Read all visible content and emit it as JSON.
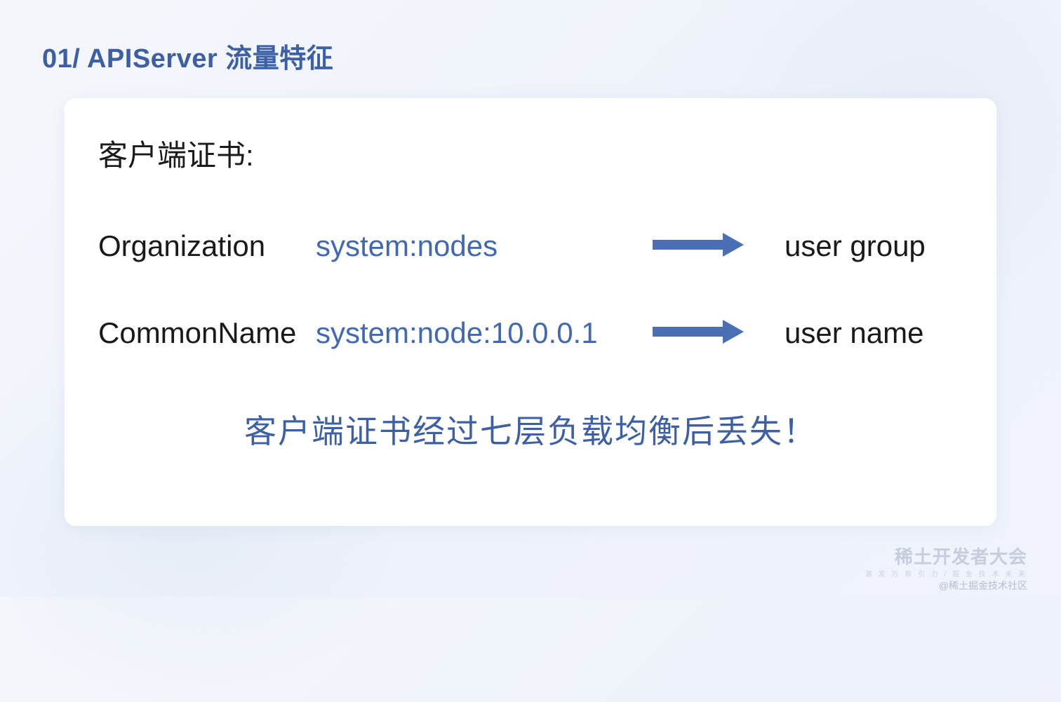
{
  "title": "01/ APIServer 流量特征",
  "card": {
    "heading": "客户端证书:",
    "rows": [
      {
        "label": "Organization",
        "value": "system:nodes",
        "result": "user group"
      },
      {
        "label": "CommonName",
        "value": "system:node:10.0.0.1",
        "result": "user name"
      }
    ],
    "conclusion": "客户端证书经过七层负载均衡后丢失！"
  },
  "watermark": {
    "logo": "稀土开发者大会",
    "sub": "激 发 万 有 引 力 / 掘 金 技 术 未 来",
    "community": "@稀土掘金技术社区"
  },
  "arrow_color": "#4a6fb5"
}
